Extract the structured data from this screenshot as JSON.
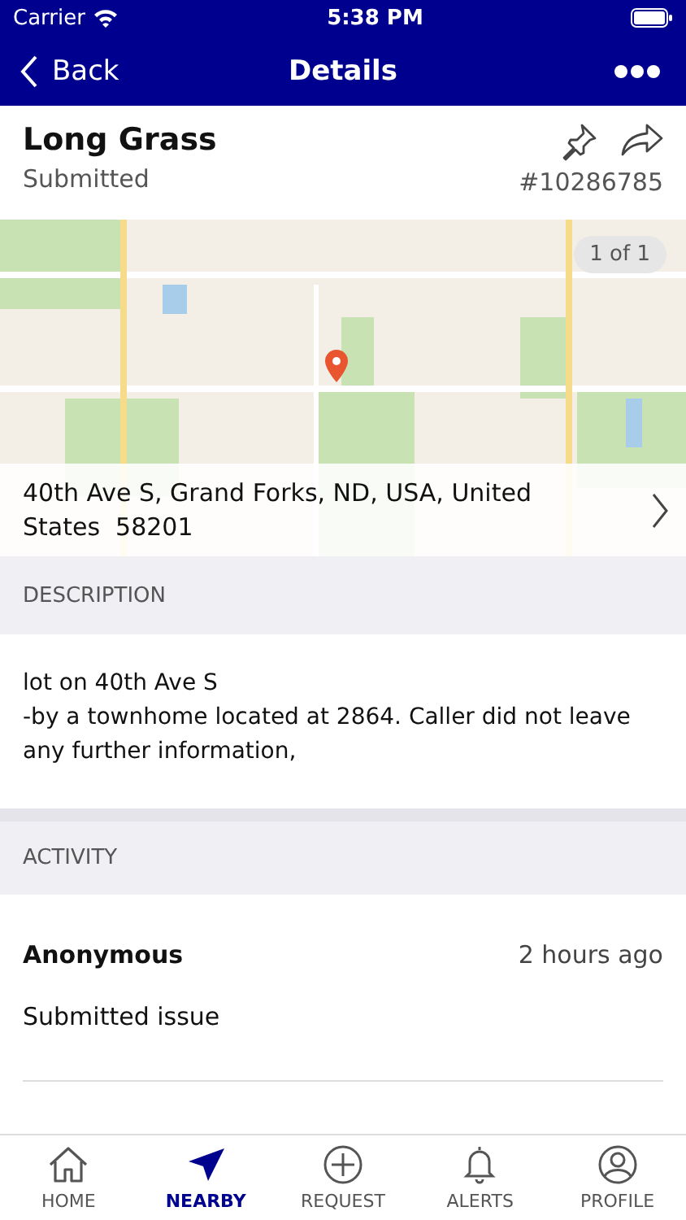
{
  "status_bar": {
    "carrier": "Carrier",
    "time": "5:38 PM"
  },
  "nav": {
    "back": "Back",
    "title": "Details"
  },
  "issue": {
    "title": "Long Grass",
    "status": "Submitted",
    "number": "#10286785"
  },
  "map": {
    "pager": "1 of 1",
    "address": "40th Ave S, Grand Forks, ND, USA, United States  58201"
  },
  "description": {
    "heading": "DESCRIPTION",
    "lines": [
      "lot on 40th Ave S",
      "-by a townhome located at 2864. Caller did not leave any further information,"
    ]
  },
  "activity": {
    "heading": "ACTIVITY",
    "items": [
      {
        "author": "Anonymous",
        "time": "2 hours ago",
        "text": "Submitted issue"
      }
    ]
  },
  "tabs": [
    {
      "kind": "home",
      "label": "HOME",
      "selected": false
    },
    {
      "kind": "nearby",
      "label": "NEARBY",
      "selected": true
    },
    {
      "kind": "request",
      "label": "REQUEST",
      "selected": false
    },
    {
      "kind": "alerts",
      "label": "ALERTS",
      "selected": false
    },
    {
      "kind": "profile",
      "label": "PROFILE",
      "selected": false
    }
  ]
}
